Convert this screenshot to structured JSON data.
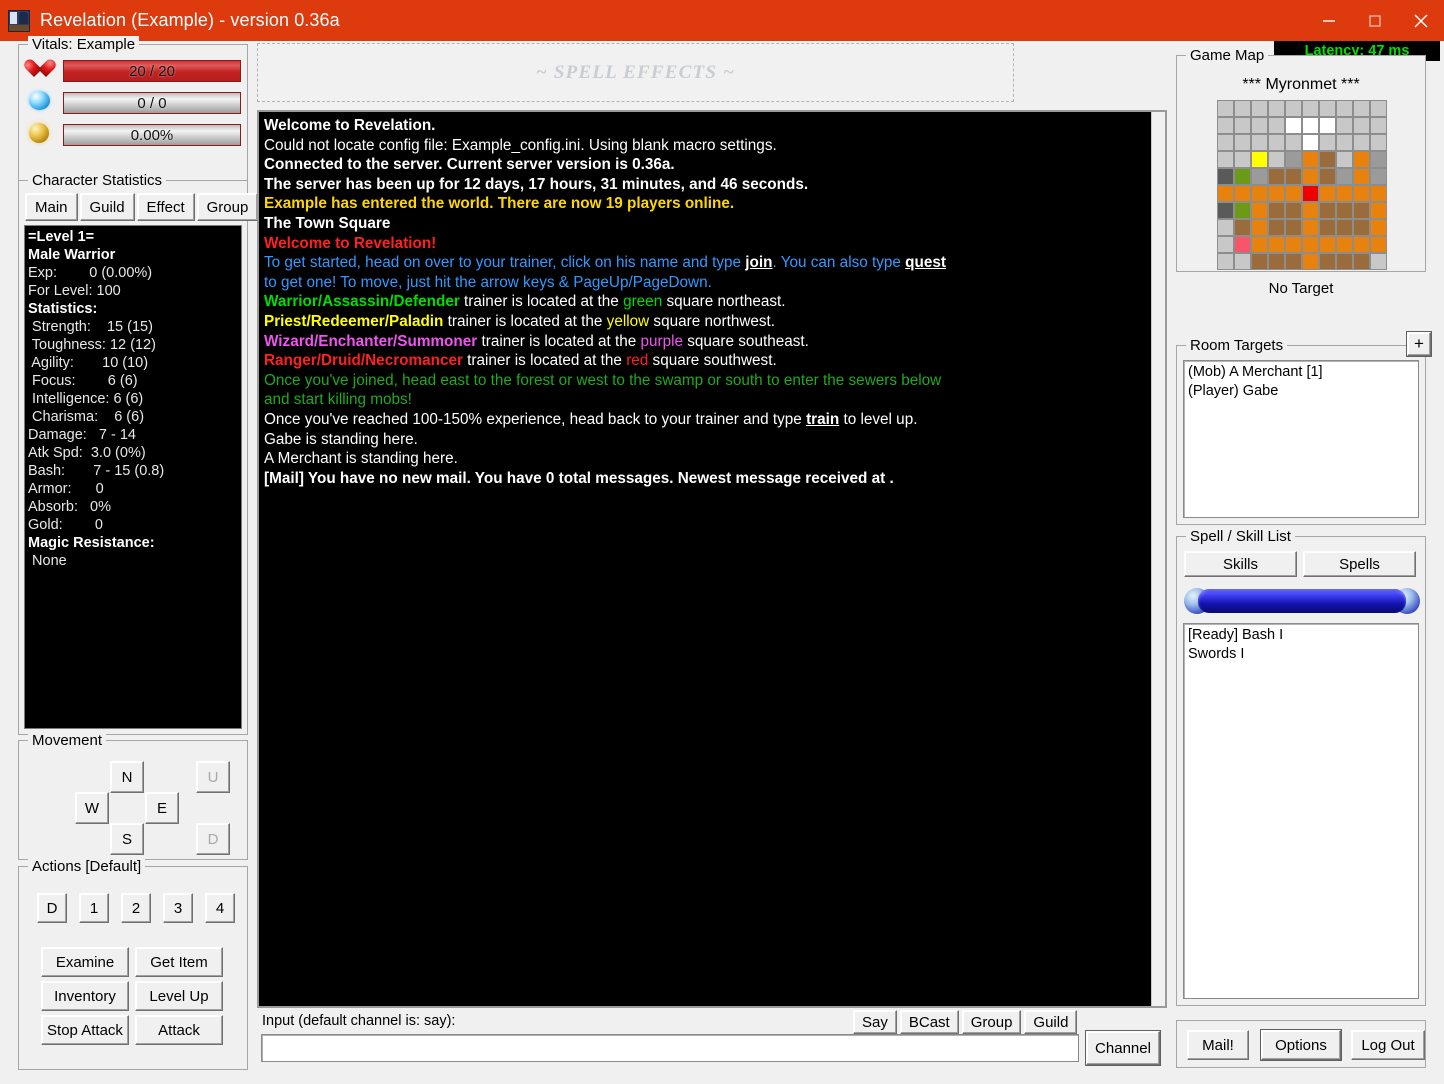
{
  "window": {
    "title": "Revelation (Example) - version 0.36a",
    "icon": "app-icon",
    "minimize": "minimize-icon",
    "maximize": "maximize-icon",
    "close": "close-icon"
  },
  "vitals": {
    "legend": "Vitals: Example",
    "rows": [
      {
        "icon": "heart-icon",
        "value": "20 / 20",
        "fill": "red",
        "color": "#c22323"
      },
      {
        "icon": "mana-orb-icon",
        "value": "0 / 0",
        "fill": "grey",
        "color": "#cdcdcd"
      },
      {
        "icon": "gold-coin-icon",
        "value": "0.00%",
        "fill": "grey",
        "color": "#cdcdcd"
      }
    ]
  },
  "character_statistics": {
    "legend": "Character Statistics",
    "tabs": [
      "Main",
      "Guild",
      "Effect",
      "Group"
    ],
    "active_tab": "Main",
    "lines": [
      {
        "text": "=Level 1=",
        "bold": true
      },
      {
        "text": "Male Warrior",
        "bold": true
      },
      {
        "text": "Exp:        0 (0.00%)",
        "bold": false
      },
      {
        "text": "For Level: 100",
        "bold": false
      },
      {
        "text": "Statistics:",
        "bold": true
      },
      {
        "text": " Strength:    15 (15)",
        "bold": false
      },
      {
        "text": " Toughness: 12 (12)",
        "bold": false
      },
      {
        "text": " Agility:       10 (10)",
        "bold": false
      },
      {
        "text": " Focus:        6 (6)",
        "bold": false
      },
      {
        "text": " Intelligence: 6 (6)",
        "bold": false
      },
      {
        "text": " Charisma:    6 (6)",
        "bold": false
      },
      {
        "text": "Damage:   7 - 14",
        "bold": false
      },
      {
        "text": "Atk Spd:  3.0 (0%)",
        "bold": false
      },
      {
        "text": "Bash:       7 - 15 (0.8)",
        "bold": false
      },
      {
        "text": "Armor:      0",
        "bold": false
      },
      {
        "text": "Absorb:   0%",
        "bold": false
      },
      {
        "text": "Gold:        0",
        "bold": false
      },
      {
        "text": "Magic Resistance:",
        "bold": true
      },
      {
        "text": " None",
        "bold": false
      }
    ]
  },
  "movement": {
    "legend": "Movement",
    "buttons": [
      {
        "label": "N",
        "disabled": false
      },
      {
        "label": "W",
        "disabled": false
      },
      {
        "label": "E",
        "disabled": false
      },
      {
        "label": "S",
        "disabled": false
      },
      {
        "label": "U",
        "disabled": true
      },
      {
        "label": "D",
        "disabled": true
      }
    ]
  },
  "actions": {
    "legend": "Actions [Default]",
    "number_buttons": [
      "D",
      "1",
      "2",
      "3",
      "4"
    ],
    "action_buttons": [
      "Examine",
      "Get Item",
      "Inventory",
      "Level Up",
      "Stop Attack",
      "Attack"
    ]
  },
  "spell_effects": {
    "label": "~ SPELL EFFECTS ~"
  },
  "chat": {
    "lines": [
      {
        "bold": true,
        "segments": [
          {
            "t": "Welcome to Revelation.",
            "c": "#ffffff"
          }
        ]
      },
      {
        "bold": false,
        "segments": [
          {
            "t": "Could not locate config file: Example_config.ini. Using blank macro settings.",
            "c": "#ffffff"
          }
        ]
      },
      {
        "bold": true,
        "segments": [
          {
            "t": "Connected to the server. Current server version is 0.36a.",
            "c": "#ffffff"
          }
        ]
      },
      {
        "bold": true,
        "segments": [
          {
            "t": "The server has been up for 12 days, 17 hours, 31 minutes, and 46 seconds.",
            "c": "#ffffff"
          }
        ]
      },
      {
        "bold": true,
        "segments": [
          {
            "t": "Example has entered the world. There are now 19 players online.",
            "c": "#ffd700"
          }
        ]
      },
      {
        "bold": true,
        "segments": [
          {
            "t": "The Town Square",
            "c": "#ffffff"
          }
        ]
      },
      {
        "bold": true,
        "segments": [
          {
            "t": " Welcome to Revelation!",
            "c": "#ff2020"
          }
        ]
      },
      {
        "bold": false,
        "segments": [
          {
            "t": "To get started, head on over to your trainer, click on his name and type ",
            "c": "#3399ff"
          },
          {
            "t": "join",
            "c": "#ffffff",
            "u": true,
            "b": true
          },
          {
            "t": ". You can also type ",
            "c": "#3399ff"
          },
          {
            "t": "quest",
            "c": "#ffffff",
            "u": true,
            "b": true
          }
        ]
      },
      {
        "bold": false,
        "segments": [
          {
            "t": "to get one! To move, just hit the arrow keys & PageUp/PageDown.",
            "c": "#3399ff"
          }
        ]
      },
      {
        "bold": false,
        "segments": [
          {
            "t": "Warrior/Assassin/Defender",
            "c": "#00dd00",
            "b": true
          },
          {
            "t": " trainer is located at the ",
            "c": "#ffffff"
          },
          {
            "t": "green",
            "c": "#00dd00"
          },
          {
            "t": " square northeast.",
            "c": "#ffffff"
          }
        ]
      },
      {
        "bold": false,
        "segments": [
          {
            "t": "Priest/Redeemer/Paladin",
            "c": "#ffff00",
            "b": true
          },
          {
            "t": " trainer is located at the ",
            "c": "#ffffff"
          },
          {
            "t": "yellow",
            "c": "#ffff00"
          },
          {
            "t": " square northwest.",
            "c": "#ffffff"
          }
        ]
      },
      {
        "bold": false,
        "segments": [
          {
            "t": "Wizard/Enchanter/Summoner",
            "c": "#ee55ee",
            "b": true
          },
          {
            "t": " trainer is located at the ",
            "c": "#ffffff"
          },
          {
            "t": "purple",
            "c": "#ee55ee"
          },
          {
            "t": " square southeast.",
            "c": "#ffffff"
          }
        ]
      },
      {
        "bold": false,
        "segments": [
          {
            "t": "Ranger/Druid/Necromancer",
            "c": "#ff2020",
            "b": true
          },
          {
            "t": " trainer is located at the ",
            "c": "#ffffff"
          },
          {
            "t": "red",
            "c": "#ff2020"
          },
          {
            "t": " square southwest.",
            "c": "#ffffff"
          }
        ]
      },
      {
        "bold": false,
        "segments": [
          {
            "t": "Once you've joined, head east to the forest or west to the swamp or south to enter the sewers below",
            "c": "#1faa1f"
          }
        ]
      },
      {
        "bold": false,
        "segments": [
          {
            "t": "and start killing mobs!",
            "c": "#1faa1f"
          }
        ]
      },
      {
        "bold": false,
        "segments": [
          {
            "t": "Once you've reached 100-150% experience, head back to your trainer and type ",
            "c": "#ffffff"
          },
          {
            "t": "train",
            "c": "#ffffff",
            "u": true,
            "b": true
          },
          {
            "t": " to level up.",
            "c": "#ffffff"
          }
        ]
      },
      {
        "bold": false,
        "segments": [
          {
            "t": " Gabe is standing here.",
            "c": "#ffffff"
          }
        ]
      },
      {
        "bold": false,
        "segments": [
          {
            "t": " A Merchant is standing here.",
            "c": "#ffffff"
          }
        ]
      },
      {
        "bold": true,
        "segments": [
          {
            "t": "[Mail] You have no new mail. You have 0 total messages. Newest message received at .",
            "c": "#ffffff"
          }
        ]
      }
    ]
  },
  "input": {
    "label": "Input (default channel is: say):",
    "value": "",
    "placeholder": "",
    "channel_buttons": [
      "Say",
      "BCast",
      "Group",
      "Guild"
    ],
    "channel_button": "Channel"
  },
  "latency": {
    "text": "Latency: 47 ms",
    "color": "#00e000"
  },
  "game_map": {
    "legend": "Game Map",
    "title": "*** Myronmet ***",
    "no_target": "No Target",
    "colors": {
      "light": "#c8c8c8",
      "white": "#ffffff",
      "orange": "#e8820e",
      "brown": "#9a6b3b",
      "grey": "#9b9b9b",
      "darkgrey": "#5a5a5a",
      "yellow": "#ffff00",
      "green": "#6b9a16",
      "red": "#ee0000",
      "pink": "#f8546a"
    },
    "grid": [
      [
        "light",
        "light",
        "light",
        "light",
        "light",
        "light",
        "light",
        "light",
        "light",
        "light"
      ],
      [
        "light",
        "light",
        "light",
        "light",
        "white",
        "white",
        "white",
        "light",
        "light",
        "light"
      ],
      [
        "light",
        "light",
        "light",
        "light",
        "light",
        "white",
        "light",
        "light",
        "light",
        "light"
      ],
      [
        "light",
        "light",
        "yellow",
        "light",
        "grey",
        "orange",
        "brown",
        "light",
        "orange",
        "grey"
      ],
      [
        "darkgrey",
        "green",
        "grey",
        "brown",
        "brown",
        "orange",
        "brown",
        "grey",
        "orange",
        "grey"
      ],
      [
        "orange",
        "orange",
        "orange",
        "orange",
        "orange",
        "red",
        "orange",
        "orange",
        "orange",
        "orange"
      ],
      [
        "darkgrey",
        "green",
        "orange",
        "brown",
        "brown",
        "orange",
        "brown",
        "brown",
        "brown",
        "orange"
      ],
      [
        "light",
        "brown",
        "orange",
        "brown",
        "brown",
        "orange",
        "brown",
        "brown",
        "brown",
        "orange"
      ],
      [
        "light",
        "pink",
        "orange",
        "orange",
        "orange",
        "orange",
        "orange",
        "orange",
        "orange",
        "orange"
      ],
      [
        "light",
        "light",
        "brown",
        "brown",
        "brown",
        "orange",
        "brown",
        "brown",
        "brown",
        "light"
      ]
    ]
  },
  "room_targets": {
    "legend": "Room Targets",
    "add_button": "+",
    "items": [
      "(Mob) A Merchant [1]",
      "(Player) Gabe"
    ]
  },
  "spell_skill_list": {
    "legend": "Spell / Skill List",
    "tabs": [
      "Skills",
      "Spells"
    ],
    "progress_color": "#2020c8",
    "items": [
      "[Ready] Bash I",
      "Swords I"
    ]
  },
  "bottom_buttons": [
    "Mail!",
    "Options",
    "Log Out"
  ]
}
